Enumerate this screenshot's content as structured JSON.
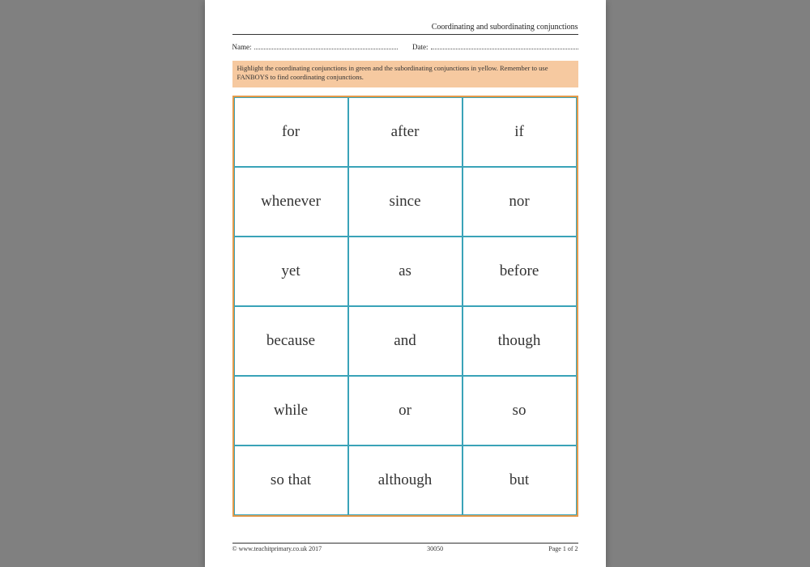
{
  "header": {
    "title": "Coordinating and subordinating conjunctions",
    "name_label": "Name:",
    "date_label": "Date:"
  },
  "instructions": "Highlight the coordinating conjunctions in green and the subordinating conjunctions in yellow. Remember to use FANBOYS to find coordinating conjunctions.",
  "grid": {
    "cells": [
      "for",
      "after",
      "if",
      "whenever",
      "since",
      "nor",
      "yet",
      "as",
      "before",
      "because",
      "and",
      "though",
      "while",
      "or",
      "so",
      "so that",
      "although",
      "but"
    ]
  },
  "footer": {
    "copyright": "© www.teachitprimary.co.uk 2017",
    "docnum": "30050",
    "page": "Page 1 of 2"
  }
}
